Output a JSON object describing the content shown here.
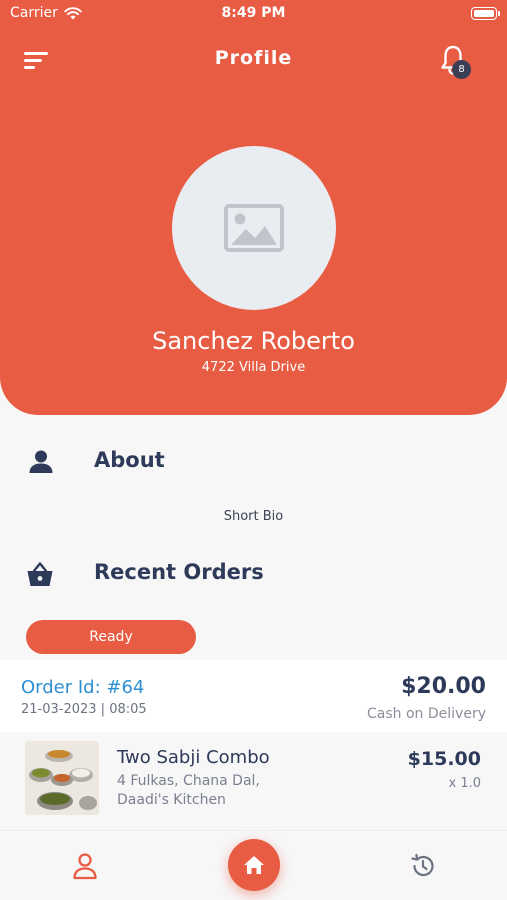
{
  "status_bar": {
    "carrier": "Carrier",
    "time": "8:49 PM"
  },
  "header": {
    "title": "Profile",
    "notification_count": "8"
  },
  "profile": {
    "name": "Sanchez Roberto",
    "address": "4722 Villa Drive"
  },
  "about": {
    "title": "About",
    "bio": "Short Bio"
  },
  "recent_orders": {
    "title": "Recent Orders",
    "status": "Ready",
    "order": {
      "id": "Order Id: #64",
      "date": "21-03-2023 | 08:05",
      "total": "$20.00",
      "payment": "Cash on Delivery",
      "items": [
        {
          "name": "Two Sabji Combo",
          "desc_line1": "4 Fulkas, Chana Dal,",
          "desc_line2": "Daadi's Kitchen",
          "price": "$15.00",
          "qty": "x 1.0"
        }
      ]
    }
  },
  "colors": {
    "accent": "#e85c43",
    "heading": "#2e3a59",
    "link": "#2e8fd1"
  },
  "icons": [
    "menu-icon",
    "bell-icon",
    "image-placeholder-icon",
    "person-icon",
    "basket-icon",
    "profile-icon",
    "home-icon",
    "history-icon"
  ]
}
